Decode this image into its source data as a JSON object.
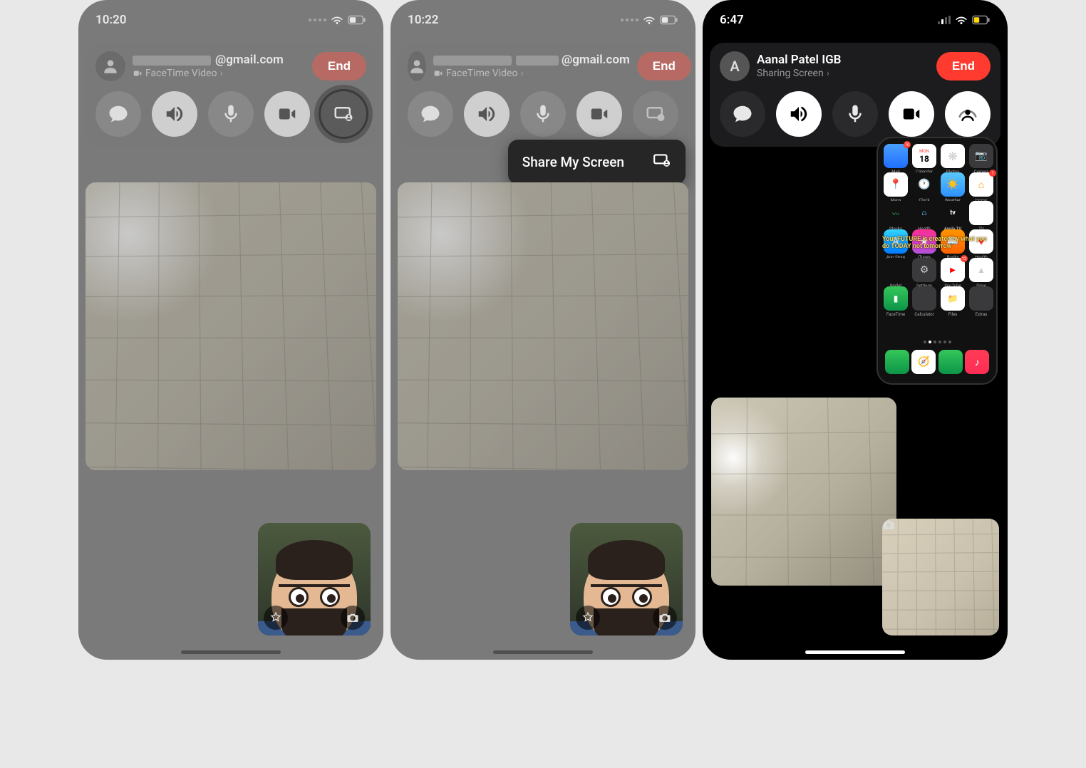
{
  "screens": {
    "s1": {
      "time": "10:20",
      "contact_suffix": "@gmail.com",
      "status_line": "FaceTime Video",
      "end_label": "End"
    },
    "s2": {
      "time": "10:22",
      "contact_suffix": "@gmail.com",
      "status_line": "FaceTime Video",
      "end_label": "End",
      "share_popup": "Share My Screen"
    },
    "s3": {
      "time": "6:47",
      "avatar_initial": "A",
      "contact_name": "Aanal Patel IGB",
      "status_line": "Sharing Screen",
      "end_label": "End",
      "motivational_text": "Your FUTURE is created by what you do TODAY not tomorrow",
      "calendar_day": "18",
      "calendar_dow": "MON",
      "apps": {
        "row1": [
          "Mail",
          "Calendar",
          "Photos",
          "Camera"
        ],
        "row2": [
          "Maps",
          "Clock",
          "Weather",
          "Home"
        ],
        "row3": [
          "Stocks",
          "Health",
          "Apple TV",
          "TV"
        ],
        "row4": [
          "App Store",
          "iTunes",
          "Books",
          "Health"
        ],
        "row5": [
          "Wallet",
          "Settings",
          "YouTube",
          "Drive"
        ],
        "row6": [
          "FaceTime",
          "Calculator",
          "Files",
          "Extras"
        ]
      },
      "dock": [
        "Phone",
        "Safari",
        "Messages",
        "Music"
      ]
    }
  },
  "icons": {
    "messages": "messages-icon",
    "speaker": "speaker-icon",
    "mic": "mic-icon",
    "camera": "camera-icon",
    "screenshare": "screenshare-icon",
    "shareplay": "shareplay-icon",
    "effects": "effects-star-icon",
    "flip": "flip-camera-icon"
  }
}
